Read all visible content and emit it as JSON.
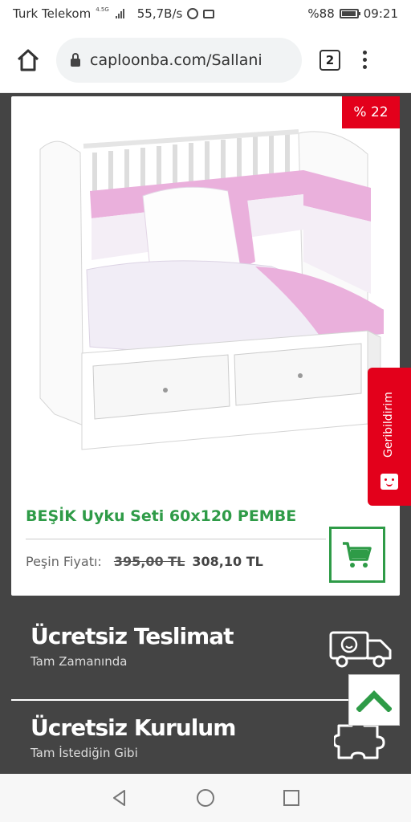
{
  "status_bar": {
    "carrier": "Turk Telekom",
    "network": "4.5G",
    "speed": "55,7B/s",
    "battery": "%88",
    "time": "09:21"
  },
  "browser": {
    "url": "caploonba.com/Sallani",
    "tab_count": "2"
  },
  "product": {
    "discount_badge": "% 22",
    "title": "BEŞİK Uyku Seti 60x120 PEMBE",
    "price_label": "Peşin Fiyatı:",
    "old_price": "395,00 TL",
    "new_price": "308,10 TL"
  },
  "features": [
    {
      "title": "Ücretsiz Teslimat",
      "subtitle": "Tam Zamanında"
    },
    {
      "title": "Ücretsiz Kurulum",
      "subtitle": "Tam İstediğin Gibi"
    }
  ],
  "feedback_tab": {
    "label": "Geribildirim"
  },
  "colors": {
    "accent_green": "#2e9b47",
    "badge_red": "#e3001b",
    "dark_bg": "#444444"
  },
  "icons": {
    "home": "home-icon",
    "lock": "lock-icon",
    "menu": "more-vert-icon",
    "cart": "cart-icon",
    "truck": "delivery-truck-icon",
    "puzzle": "puzzle-icon",
    "arrow_up": "chevron-up-icon"
  }
}
